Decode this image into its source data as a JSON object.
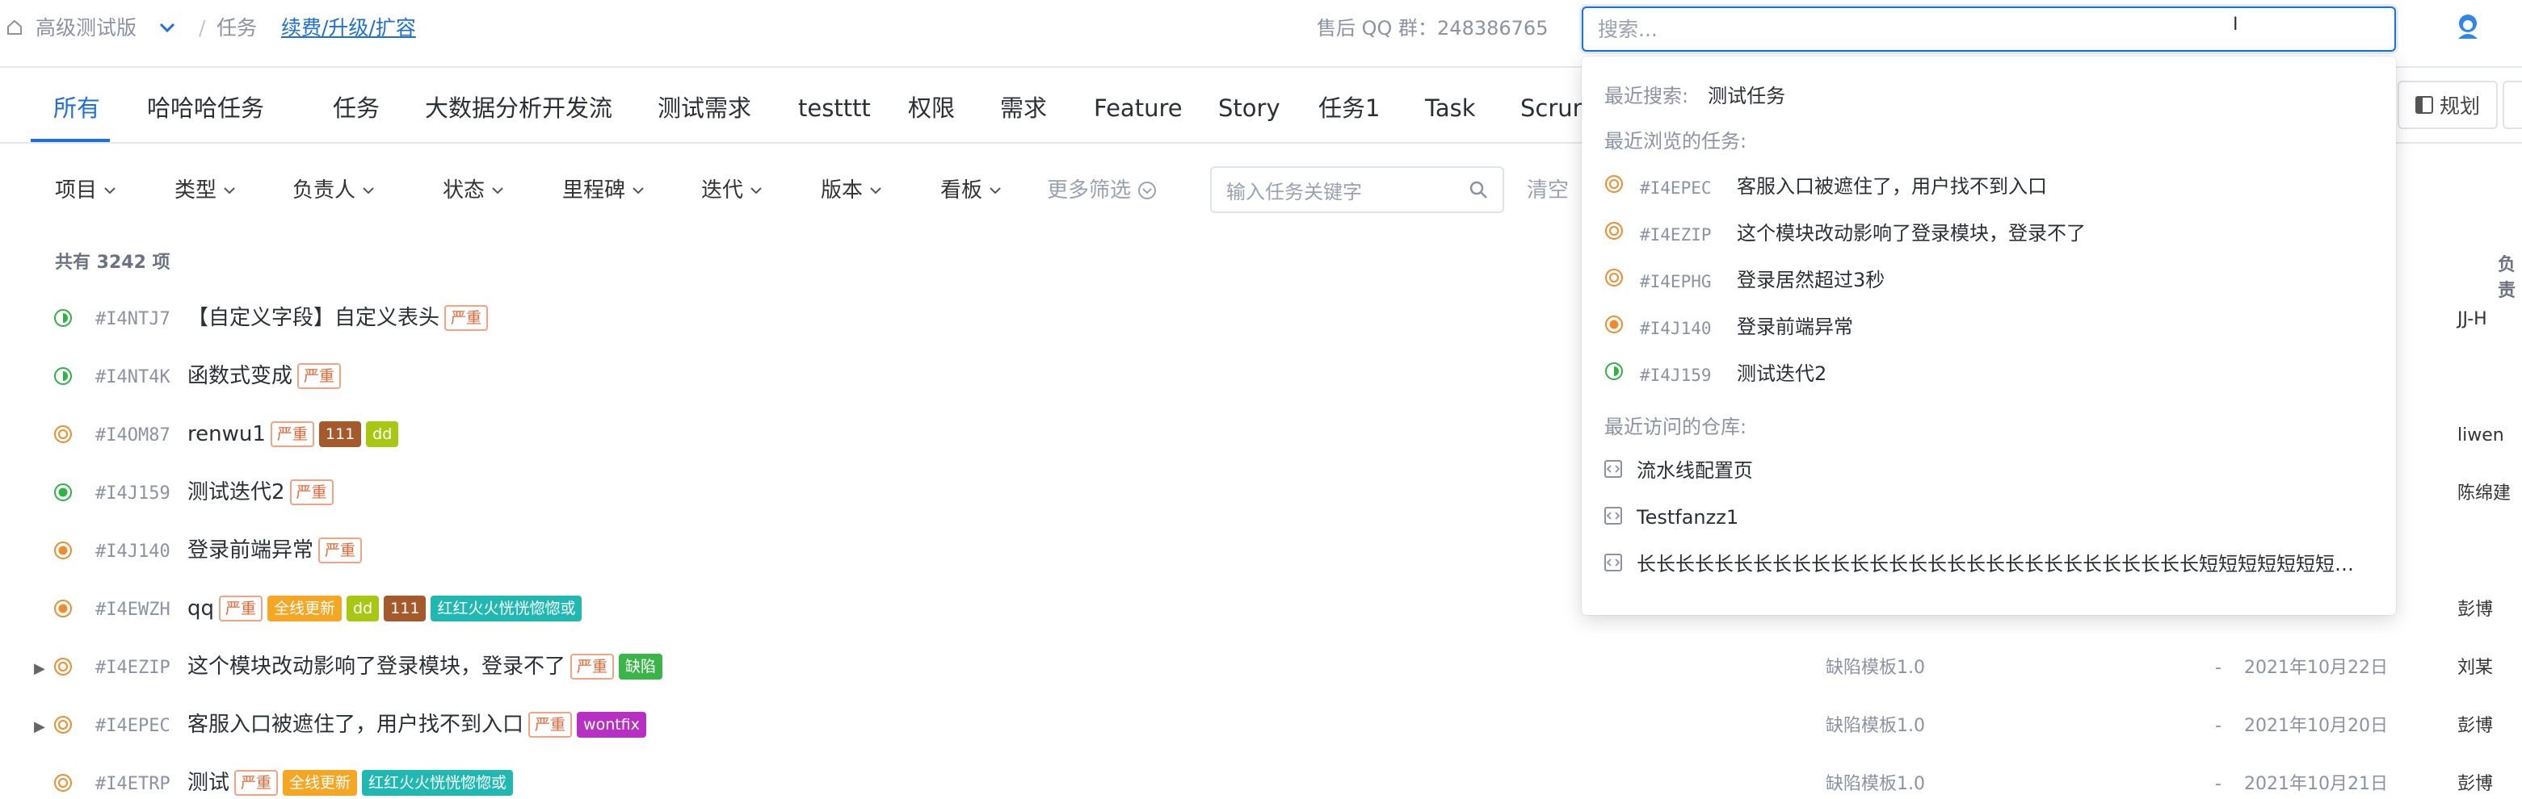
{
  "header": {
    "workspace": "高级测试版",
    "separator": "/",
    "section": "任务",
    "upgrade_link": "续费/升级/扩容",
    "qq_group": "售后 QQ 群：248386765"
  },
  "search": {
    "placeholder": "搜索..."
  },
  "tabs": [
    {
      "label": "所有"
    },
    {
      "label": "哈哈哈任务"
    },
    {
      "label": "任务"
    },
    {
      "label": "大数据分析开发流"
    },
    {
      "label": "测试需求"
    },
    {
      "label": "testttt"
    },
    {
      "label": "权限"
    },
    {
      "label": "需求"
    },
    {
      "label": "Feature"
    },
    {
      "label": "Story"
    },
    {
      "label": "任务1"
    },
    {
      "label": "Task"
    },
    {
      "label": "Scrum"
    }
  ],
  "plan_button": "规划",
  "filters": [
    {
      "label": "项目"
    },
    {
      "label": "类型"
    },
    {
      "label": "负责人"
    },
    {
      "label": "状态"
    },
    {
      "label": "里程碑"
    },
    {
      "label": "迭代"
    },
    {
      "label": "版本"
    },
    {
      "label": "看板"
    }
  ],
  "more_filters": "更多筛选",
  "keyword_placeholder": "输入任务关键字",
  "clear_label": "清空",
  "count_label": "共有 3242 项",
  "owner_header": "负责",
  "rows": [
    {
      "id": "#I4NTJ7",
      "title": "【自定义字段】自定义表头",
      "status": "half",
      "tags": [
        {
          "t": "严重",
          "k": "sev"
        }
      ],
      "template": "",
      "dash": "",
      "date": "",
      "owner": "JJ-H"
    },
    {
      "id": "#I4NT4K",
      "title": "函数式变成",
      "status": "half",
      "tags": [
        {
          "t": "严重",
          "k": "sev"
        }
      ],
      "template": "",
      "dash": "",
      "date": "",
      "owner": ""
    },
    {
      "id": "#I4OM87",
      "title": "renwu1",
      "status": "open",
      "tags": [
        {
          "t": "严重",
          "k": "sev"
        },
        {
          "t": "111",
          "k": "brown"
        },
        {
          "t": "dd",
          "k": "lime"
        }
      ],
      "template": "",
      "dash": "",
      "date": "",
      "owner": "liwen"
    },
    {
      "id": "#I4J159",
      "title": "测试迭代2",
      "status": "done",
      "tags": [
        {
          "t": "严重",
          "k": "sev"
        }
      ],
      "template": "",
      "dash": "",
      "date": "",
      "owner": "陈绵建"
    },
    {
      "id": "#I4J140",
      "title": "登录前端异常",
      "status": "progress",
      "tags": [
        {
          "t": "严重",
          "k": "sev"
        }
      ],
      "template": "",
      "dash": "",
      "date": "",
      "owner": ""
    },
    {
      "id": "#I4EWZH",
      "title": "qq",
      "status": "progress",
      "tags": [
        {
          "t": "严重",
          "k": "sev"
        },
        {
          "t": "全线更新",
          "k": "orange"
        },
        {
          "t": "dd",
          "k": "lime"
        },
        {
          "t": "111",
          "k": "brown"
        },
        {
          "t": "红红火火恍恍惚惚或",
          "k": "teal"
        }
      ],
      "template": "",
      "dash": "",
      "date": "",
      "owner": "彭博"
    },
    {
      "id": "#I4EZIP",
      "title": "这个模块改动影响了登录模块，登录不了",
      "status": "open",
      "expand": true,
      "tags": [
        {
          "t": "严重",
          "k": "sev"
        },
        {
          "t": "缺陷",
          "k": "green"
        }
      ],
      "template": "缺陷模板1.0",
      "dash": "-",
      "date": "2021年10月22日",
      "owner": "刘某"
    },
    {
      "id": "#I4EPEC",
      "title": "客服入口被遮住了，用户找不到入口",
      "status": "open",
      "expand": true,
      "tags": [
        {
          "t": "严重",
          "k": "sev"
        },
        {
          "t": "wontfix",
          "k": "purple"
        }
      ],
      "template": "缺陷模板1.0",
      "dash": "-",
      "date": "2021年10月20日",
      "owner": "彭博"
    },
    {
      "id": "#I4ETRP",
      "title": "测试",
      "status": "open",
      "tags": [
        {
          "t": "严重",
          "k": "sev"
        },
        {
          "t": "全线更新",
          "k": "orange"
        },
        {
          "t": "红红火火恍恍惚惚或",
          "k": "teal"
        }
      ],
      "template": "缺陷模板1.0",
      "dash": "-",
      "date": "2021年10月21日",
      "owner": "彭博"
    }
  ],
  "dropdown": {
    "recent_search_label": "最近搜索:",
    "recent_search_value": "测试任务",
    "recent_tasks_label": "最近浏览的任务:",
    "recent_tasks": [
      {
        "id": "#I4EPEC",
        "title": "客服入口被遮住了，用户找不到入口",
        "status": "open"
      },
      {
        "id": "#I4EZIP",
        "title": "这个模块改动影响了登录模块，登录不了",
        "status": "open"
      },
      {
        "id": "#I4EPHG",
        "title": "登录居然超过3秒",
        "status": "open"
      },
      {
        "id": "#I4J140",
        "title": "登录前端异常",
        "status": "progress"
      },
      {
        "id": "#I4J159",
        "title": "测试迭代2",
        "status": "half"
      }
    ],
    "recent_repos_label": "最近访问的仓库:",
    "recent_repos": [
      {
        "name": "流水线配置页"
      },
      {
        "name": "Testfanzz1"
      },
      {
        "name": "长长长长长长长长长长长长长长长长长长长长长长长长长长长长长短短短短短短短短短..."
      }
    ]
  },
  "colors": {
    "accent": "#1e6fd9",
    "severity": "#ee6433",
    "open": "#f08c2e",
    "done": "#2fb344",
    "brown": "#a45a2a",
    "lime": "#a7c713",
    "orange": "#f5a623",
    "teal": "#21b8b1",
    "green": "#3bb54a",
    "purple": "#b82fc4"
  }
}
